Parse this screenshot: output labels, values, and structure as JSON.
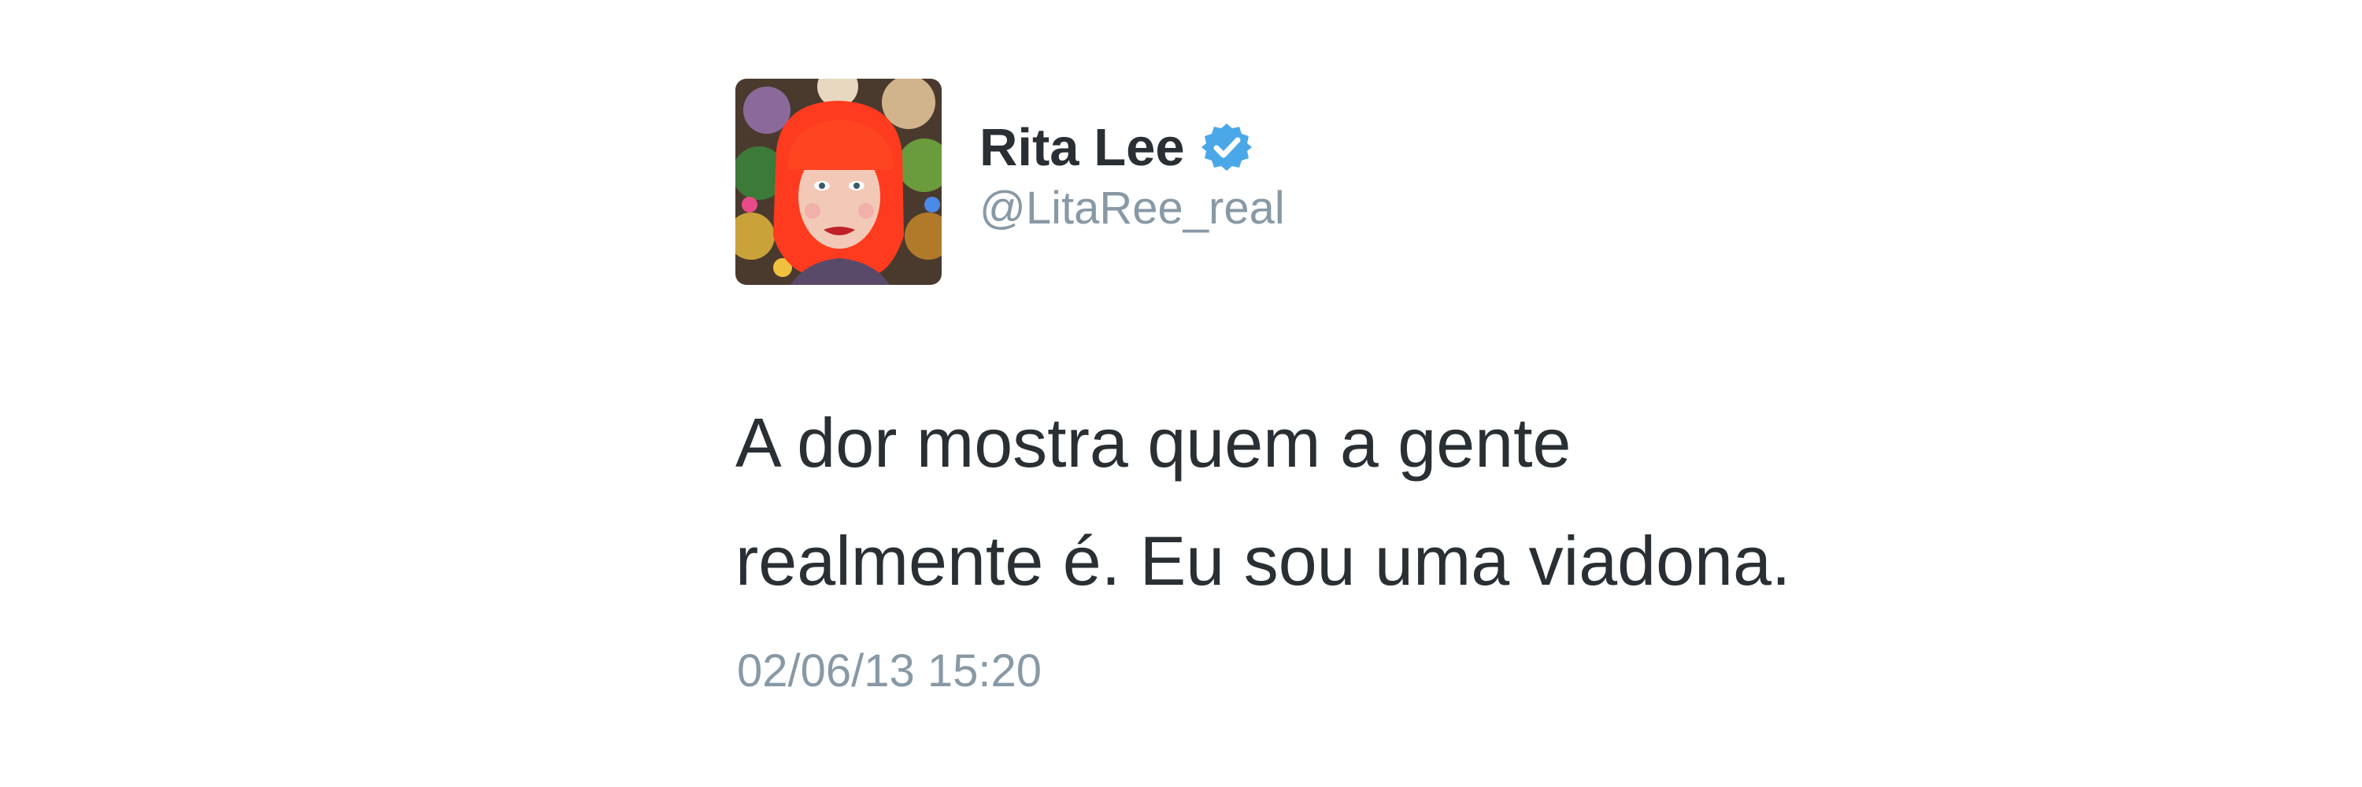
{
  "tweet": {
    "author": {
      "display_name": "Rita Lee",
      "handle": "@LitaRee_real",
      "verified": true,
      "verified_icon": "verified-badge-icon",
      "avatar_icon": "avatar"
    },
    "text_lines": [
      "A dor mostra quem a gente",
      "realmente é. Eu sou uma viadona."
    ],
    "timestamp": "02/06/13 15:20"
  },
  "colors": {
    "name_text": "#292f33",
    "secondary_text": "#8899a6",
    "verified_badge": "#1da1f2",
    "background": "#ffffff"
  }
}
